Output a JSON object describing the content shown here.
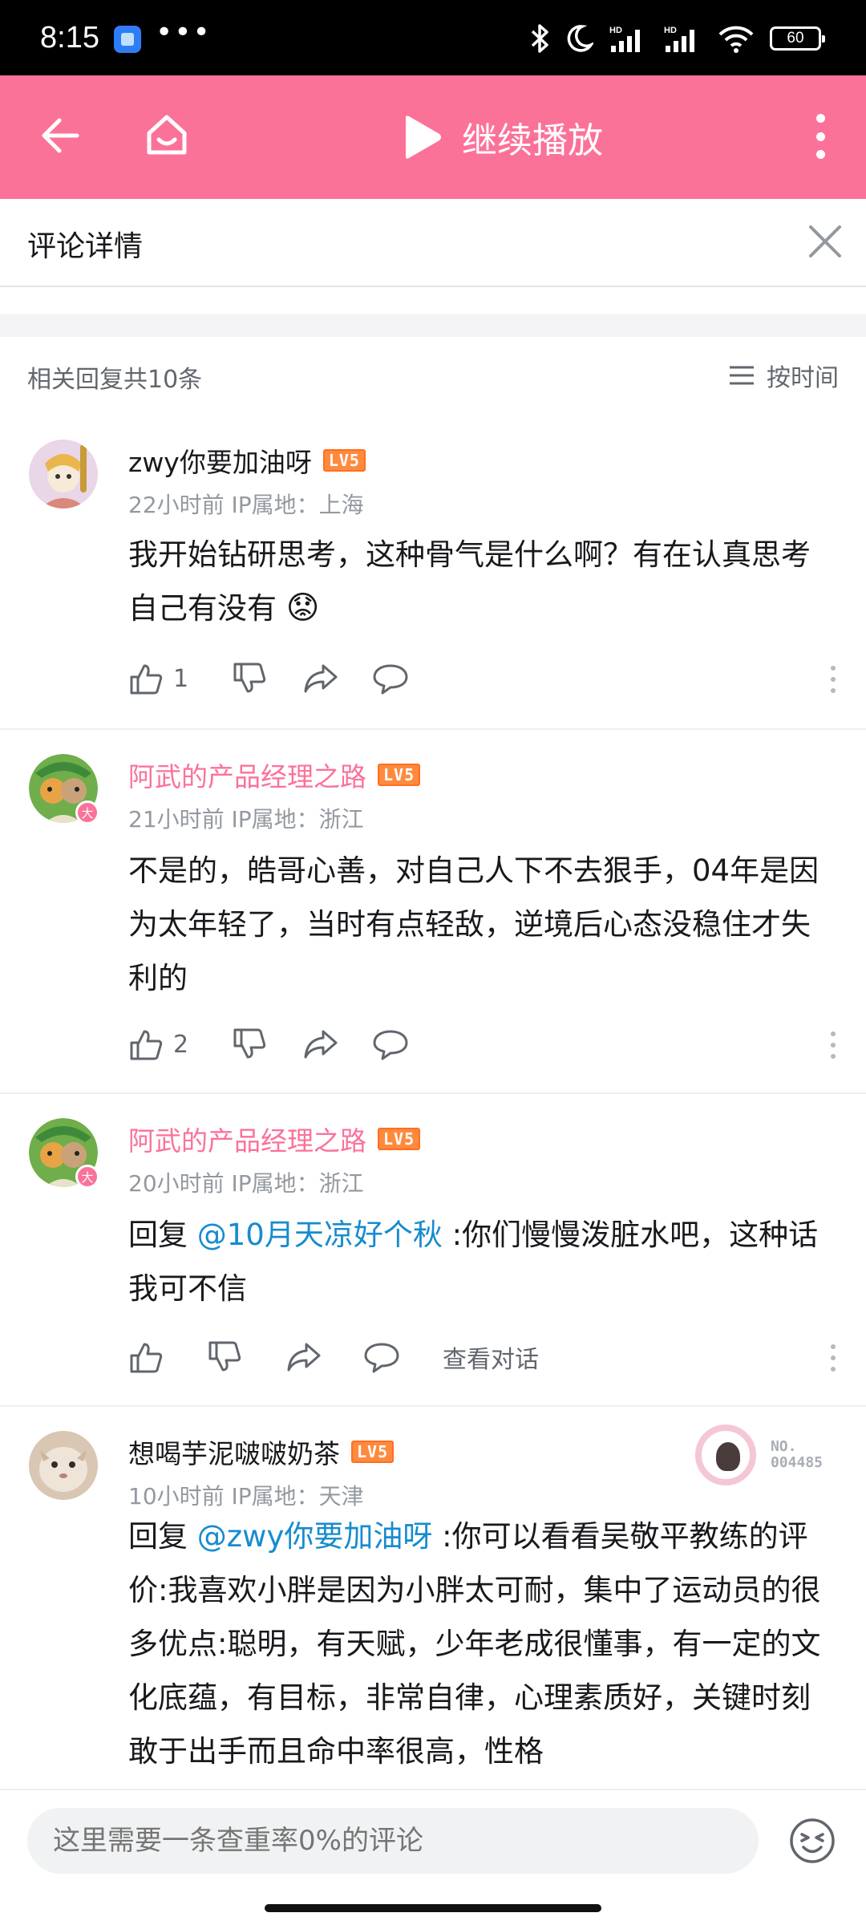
{
  "status_bar": {
    "time": "8:15",
    "dots": "•••",
    "signal": "HD",
    "battery": "60"
  },
  "top_nav": {
    "play_label": "继续播放"
  },
  "detail": {
    "title": "评论详情"
  },
  "replies_header": {
    "count_label": "相关回复共10条",
    "sort_label": "按时间"
  },
  "comments": [
    {
      "username": "zwy你要加油呀",
      "level": "LV5",
      "meta": "22小时前 IP属地：上海",
      "text": "我开始钻研思考，这种骨气是什么啊？有在认真思考自己有没有",
      "emoji": "😟",
      "likes": "1"
    },
    {
      "username": "阿武的产品经理之路",
      "level": "LV5",
      "badge": "大",
      "meta": "21小时前 IP属地：浙江",
      "text": "不是的，皓哥心善，对自己人下不去狠手，04年是因为太年轻了，当时有点轻敌，逆境后心态没稳住才失利的",
      "likes": "2"
    },
    {
      "username": "阿武的产品经理之路",
      "level": "LV5",
      "badge": "大",
      "meta": "20小时前 IP属地：浙江",
      "reply_prefix": "回复 ",
      "mention": "@10月天凉好个秋",
      "text": " :你们慢慢泼脏水吧，这种话我可不信",
      "view_conversation": "查看对话"
    },
    {
      "username": "想喝芋泥啵啵奶茶",
      "level": "LV5",
      "meta": "10小时前 IP属地：天津",
      "garb_no_line1": "NO.",
      "garb_no_line2": "004485",
      "reply_prefix": "回复 ",
      "mention": "@zwy你要加油呀",
      "text": " :你可以看看吴敬平教练的评价:我喜欢小胖是因为小胖太可耐，集中了运动员的很多优点:聪明，有天赋，少年老成很懂事，有一定的文化底蕴，有目标，非常自律，心理素质好，关键时刻敢于出手而且命中率很高，性格"
    }
  ],
  "input": {
    "placeholder": "这里需要一条查重率0%的评论"
  }
}
